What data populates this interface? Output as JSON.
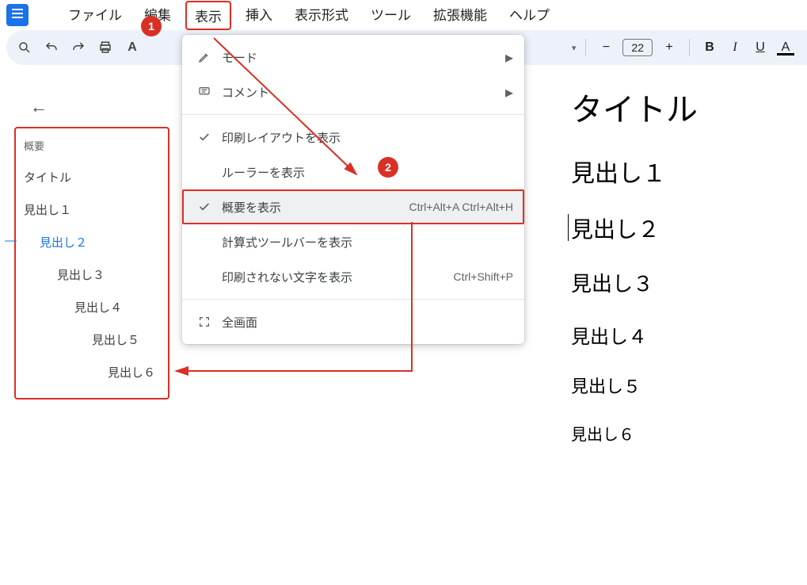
{
  "menubar": {
    "items": [
      "ファイル",
      "編集",
      "表示",
      "挿入",
      "表示形式",
      "ツール",
      "拡張機能",
      "ヘルプ"
    ],
    "active_index": 2
  },
  "toolbar": {
    "font_size": "22"
  },
  "outline": {
    "header": "概要",
    "items": [
      {
        "label": "タイトル",
        "indent": 1,
        "active": false
      },
      {
        "label": "見出し１",
        "indent": 1,
        "active": false
      },
      {
        "label": "見出し２",
        "indent": 2,
        "active": true
      },
      {
        "label": "見出し３",
        "indent": 3,
        "active": false
      },
      {
        "label": "見出し４",
        "indent": 4,
        "active": false
      },
      {
        "label": "見出し５",
        "indent": 5,
        "active": false
      },
      {
        "label": "見出し６",
        "indent": 6,
        "active": false
      }
    ]
  },
  "view_menu": {
    "rows": [
      {
        "icon": "pencil",
        "label": "モード",
        "submenu": true
      },
      {
        "icon": "comment",
        "label": "コメント",
        "submenu": true
      },
      {
        "sep": true
      },
      {
        "icon": "check",
        "label": "印刷レイアウトを表示"
      },
      {
        "label": "ルーラーを表示"
      },
      {
        "icon": "check",
        "label": "概要を表示",
        "kbd": "Ctrl+Alt+A Ctrl+Alt+H",
        "highlight": true
      },
      {
        "label": "計算式ツールバーを表示"
      },
      {
        "label": "印刷されない文字を表示",
        "kbd": "Ctrl+Shift+P"
      },
      {
        "sep": true
      },
      {
        "icon": "fullscreen",
        "label": "全画面"
      }
    ]
  },
  "document": {
    "title": "タイトル",
    "h1": "見出し１",
    "h2": "見出し２",
    "h3": "見出し３",
    "h4": "見出し４",
    "h5": "見出し５",
    "h6": "見出し６"
  },
  "annotations": {
    "badge1": "1",
    "badge2": "2"
  }
}
